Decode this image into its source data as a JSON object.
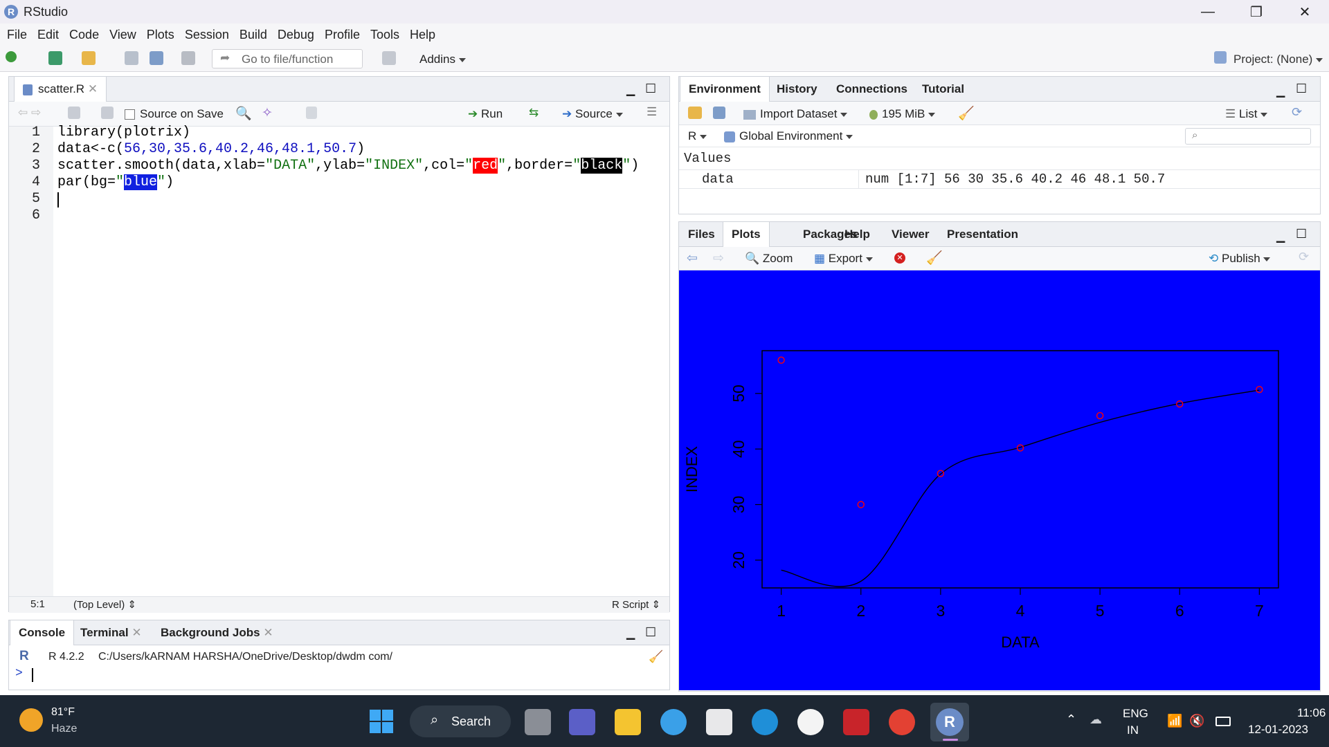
{
  "window": {
    "title": "RStudio",
    "app_letter": "R"
  },
  "menu": [
    "File",
    "Edit",
    "Code",
    "View",
    "Plots",
    "Session",
    "Build",
    "Debug",
    "Profile",
    "Tools",
    "Help"
  ],
  "toolbar": {
    "goto_placeholder": "Go to file/function",
    "addins": "Addins",
    "project": "Project: (None)"
  },
  "editor": {
    "tab": "scatter.R",
    "source_on_save": "Source on Save",
    "run": "Run",
    "source": "Source",
    "lines": [
      "1",
      "2",
      "3",
      "4",
      "5",
      "6"
    ],
    "code": {
      "l1": "library(plotrix)",
      "l2a": "data<-c(",
      "l2nums": "56,30,35.6,40.2,46,48.1,50.7",
      "l2b": ")",
      "l3a": "scatter.smooth(data,xlab=",
      "l3s1": "\"DATA\"",
      "l3b": ",ylab=",
      "l3s2": "\"INDEX\"",
      "l3c": ",col=",
      "l3q": "\"",
      "l3red": "red",
      "l3d": ",border=",
      "l3black": "black",
      "l3e": ")",
      "l4a": "par(bg=",
      "l4blue": "blue",
      "l4b": ")"
    },
    "status_pos": "5:1",
    "status_level": "(Top Level)",
    "status_type": "R Script"
  },
  "console": {
    "tabs": [
      "Console",
      "Terminal",
      "Background Jobs"
    ],
    "version": "R 4.2.2",
    "path": "C:/Users/kARNAM HARSHA/OneDrive/Desktop/dwdm com/",
    "prompt": ">"
  },
  "environment": {
    "tabs": [
      "Environment",
      "History",
      "Connections",
      "Tutorial"
    ],
    "import": "Import Dataset",
    "memory": "195 MiB",
    "list": "List",
    "lang": "R",
    "scope": "Global Environment",
    "section": "Values",
    "var_name": "data",
    "var_value": "num [1:7] 56 30 35.6 40.2 46 48.1 50.7"
  },
  "files_pane": {
    "tabs": [
      "Files",
      "Plots",
      "Packages",
      "Help",
      "Viewer",
      "Presentation"
    ],
    "zoom": "Zoom",
    "export": "Export",
    "publish": "Publish"
  },
  "chart_data": {
    "type": "scatter",
    "x": [
      1,
      2,
      3,
      4,
      5,
      6,
      7
    ],
    "y": [
      56,
      30,
      35.6,
      40.2,
      46,
      48.1,
      50.7
    ],
    "smooth_y": [
      18.2,
      16.2,
      35.5,
      40.3,
      44.8,
      48.2,
      50.6
    ],
    "xlabel": "DATA",
    "ylabel": "INDEX",
    "xticks": [
      "1",
      "2",
      "3",
      "4",
      "5",
      "6",
      "7"
    ],
    "yticks": [
      "20",
      "30",
      "40",
      "50"
    ],
    "xlim": [
      0.76,
      7.24
    ],
    "ylim": [
      15.0,
      57.7
    ],
    "background": "#0000ff",
    "point_color": "#ff0000",
    "line_color": "#000000"
  },
  "taskbar": {
    "temp": "81°F",
    "weather": "Haze",
    "search": "Search",
    "lang1": "ENG",
    "lang2": "IN",
    "time": "11:06",
    "date": "12-01-2023"
  }
}
